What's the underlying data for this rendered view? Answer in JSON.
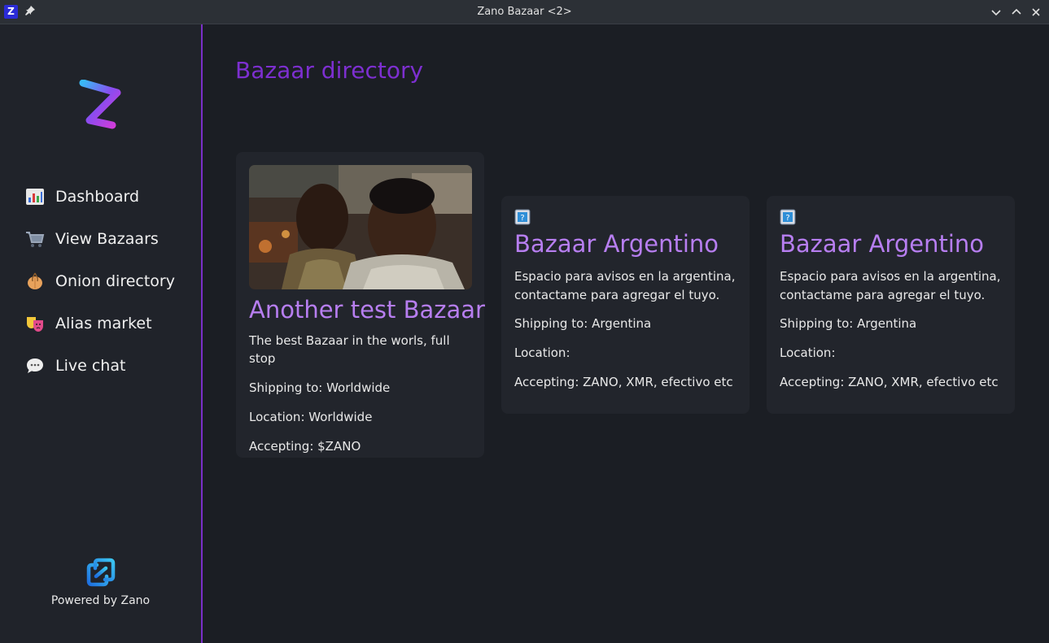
{
  "window": {
    "title": "Zano Bazaar <2>"
  },
  "sidebar": {
    "items": [
      {
        "label": "Dashboard",
        "icon": "bar-chart-icon"
      },
      {
        "label": "View Bazaars",
        "icon": "shopping-cart-icon"
      },
      {
        "label": "Onion directory",
        "icon": "onion-icon"
      },
      {
        "label": "Alias market",
        "icon": "theater-masks-icon"
      },
      {
        "label": "Live chat",
        "icon": "speech-bubble-icon"
      }
    ],
    "powered_by": "Powered by Zano"
  },
  "main": {
    "title": "Bazaar directory",
    "cards": [
      {
        "title": "Another test Bazaar",
        "description": "The best Bazaar in the worls, full stop",
        "shipping": "Shipping to: Worldwide",
        "location": "Location: Worldwide",
        "accepting": "Accepting: $ZANO"
      },
      {
        "title": "Bazaar Argentino",
        "description": "Espacio para avisos en la argentina, contactame para agregar el tuyo.",
        "shipping": "Shipping to: Argentina",
        "location": "Location:",
        "accepting": "Accepting: ZANO, XMR, efectivo etc"
      },
      {
        "title": "Bazaar Argentino",
        "description": "Espacio para avisos en la argentina, contactame para agregar el tuyo.",
        "shipping": "Shipping to: Argentina",
        "location": "Location:",
        "accepting": "Accepting: ZANO, XMR, efectivo etc"
      }
    ]
  },
  "colors": {
    "accent": "#7d2fd0",
    "card_title": "#b77ef0",
    "background": "#1b1e24",
    "sidebar": "#20232a",
    "card": "#22252c"
  }
}
